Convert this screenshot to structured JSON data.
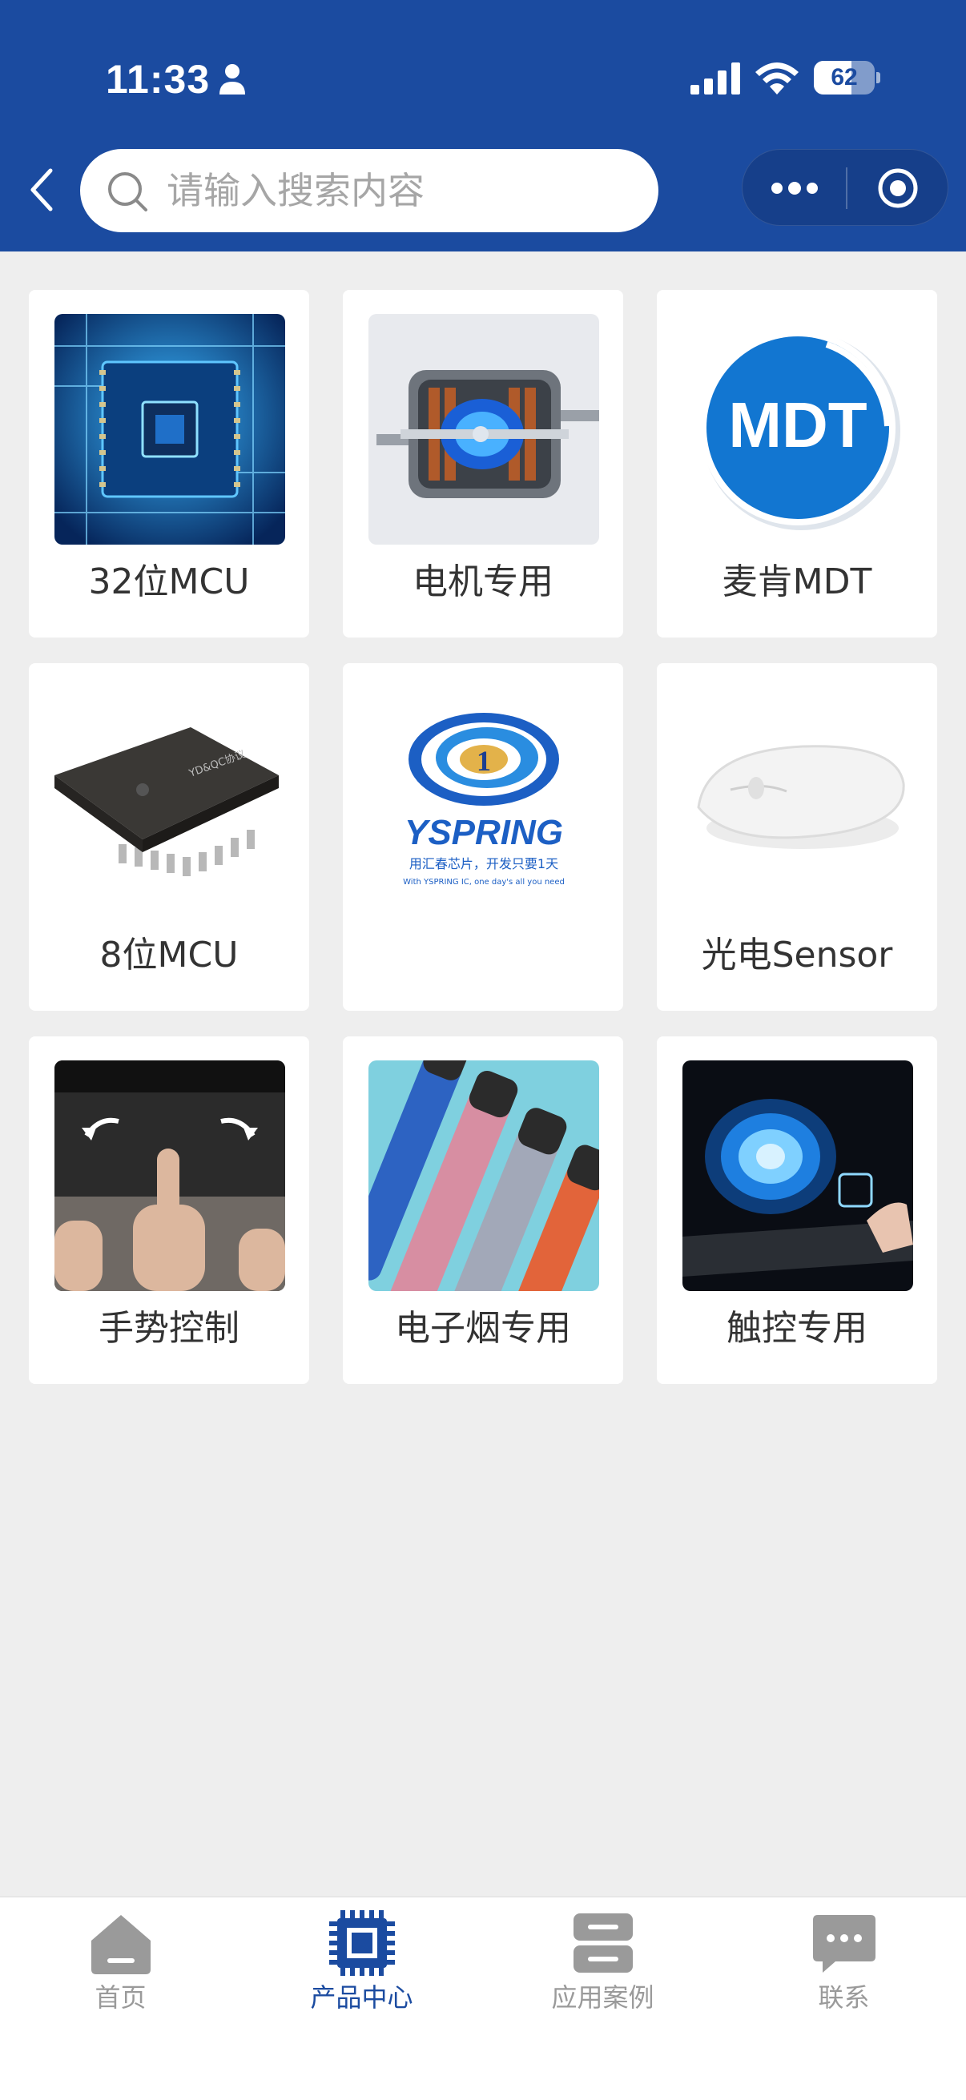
{
  "status_bar": {
    "time": "11:33",
    "battery": "62",
    "battery_level": 0.62
  },
  "search": {
    "placeholder": "请输入搜索内容"
  },
  "products": [
    {
      "label": "32位MCU",
      "icon": "mcu-chip-image"
    },
    {
      "label": "电机专用",
      "icon": "motor-image"
    },
    {
      "label": "麦肯MDT",
      "icon": "mdt-logo",
      "logo_text": "MDT"
    },
    {
      "label": "8位MCU",
      "icon": "soic-chip-image",
      "logo_text": "YD&QC协议"
    },
    {
      "label": "",
      "icon": "yspring-logo",
      "logo_text": "YSPRING",
      "logo_subtitle": "用汇春芯片，开发只要1天",
      "logo_tagline": "With YSPRING IC, one day's all you need"
    },
    {
      "label": "光电Sensor",
      "icon": "mouse-image"
    },
    {
      "label": "手势控制",
      "icon": "gesture-image"
    },
    {
      "label": "电子烟专用",
      "icon": "ecig-image"
    },
    {
      "label": "触控专用",
      "icon": "touch-hood-image"
    }
  ],
  "tabbar": {
    "tabs": [
      {
        "label": "首页",
        "icon": "home-icon"
      },
      {
        "label": "产品中心",
        "icon": "chip-icon"
      },
      {
        "label": "应用案例",
        "icon": "cases-icon"
      },
      {
        "label": "联系",
        "icon": "chat-icon"
      }
    ],
    "active_index": 1
  },
  "colors": {
    "brand": "#1b4ba0",
    "inactive": "#9a9a9a",
    "background": "#eeeeee"
  }
}
